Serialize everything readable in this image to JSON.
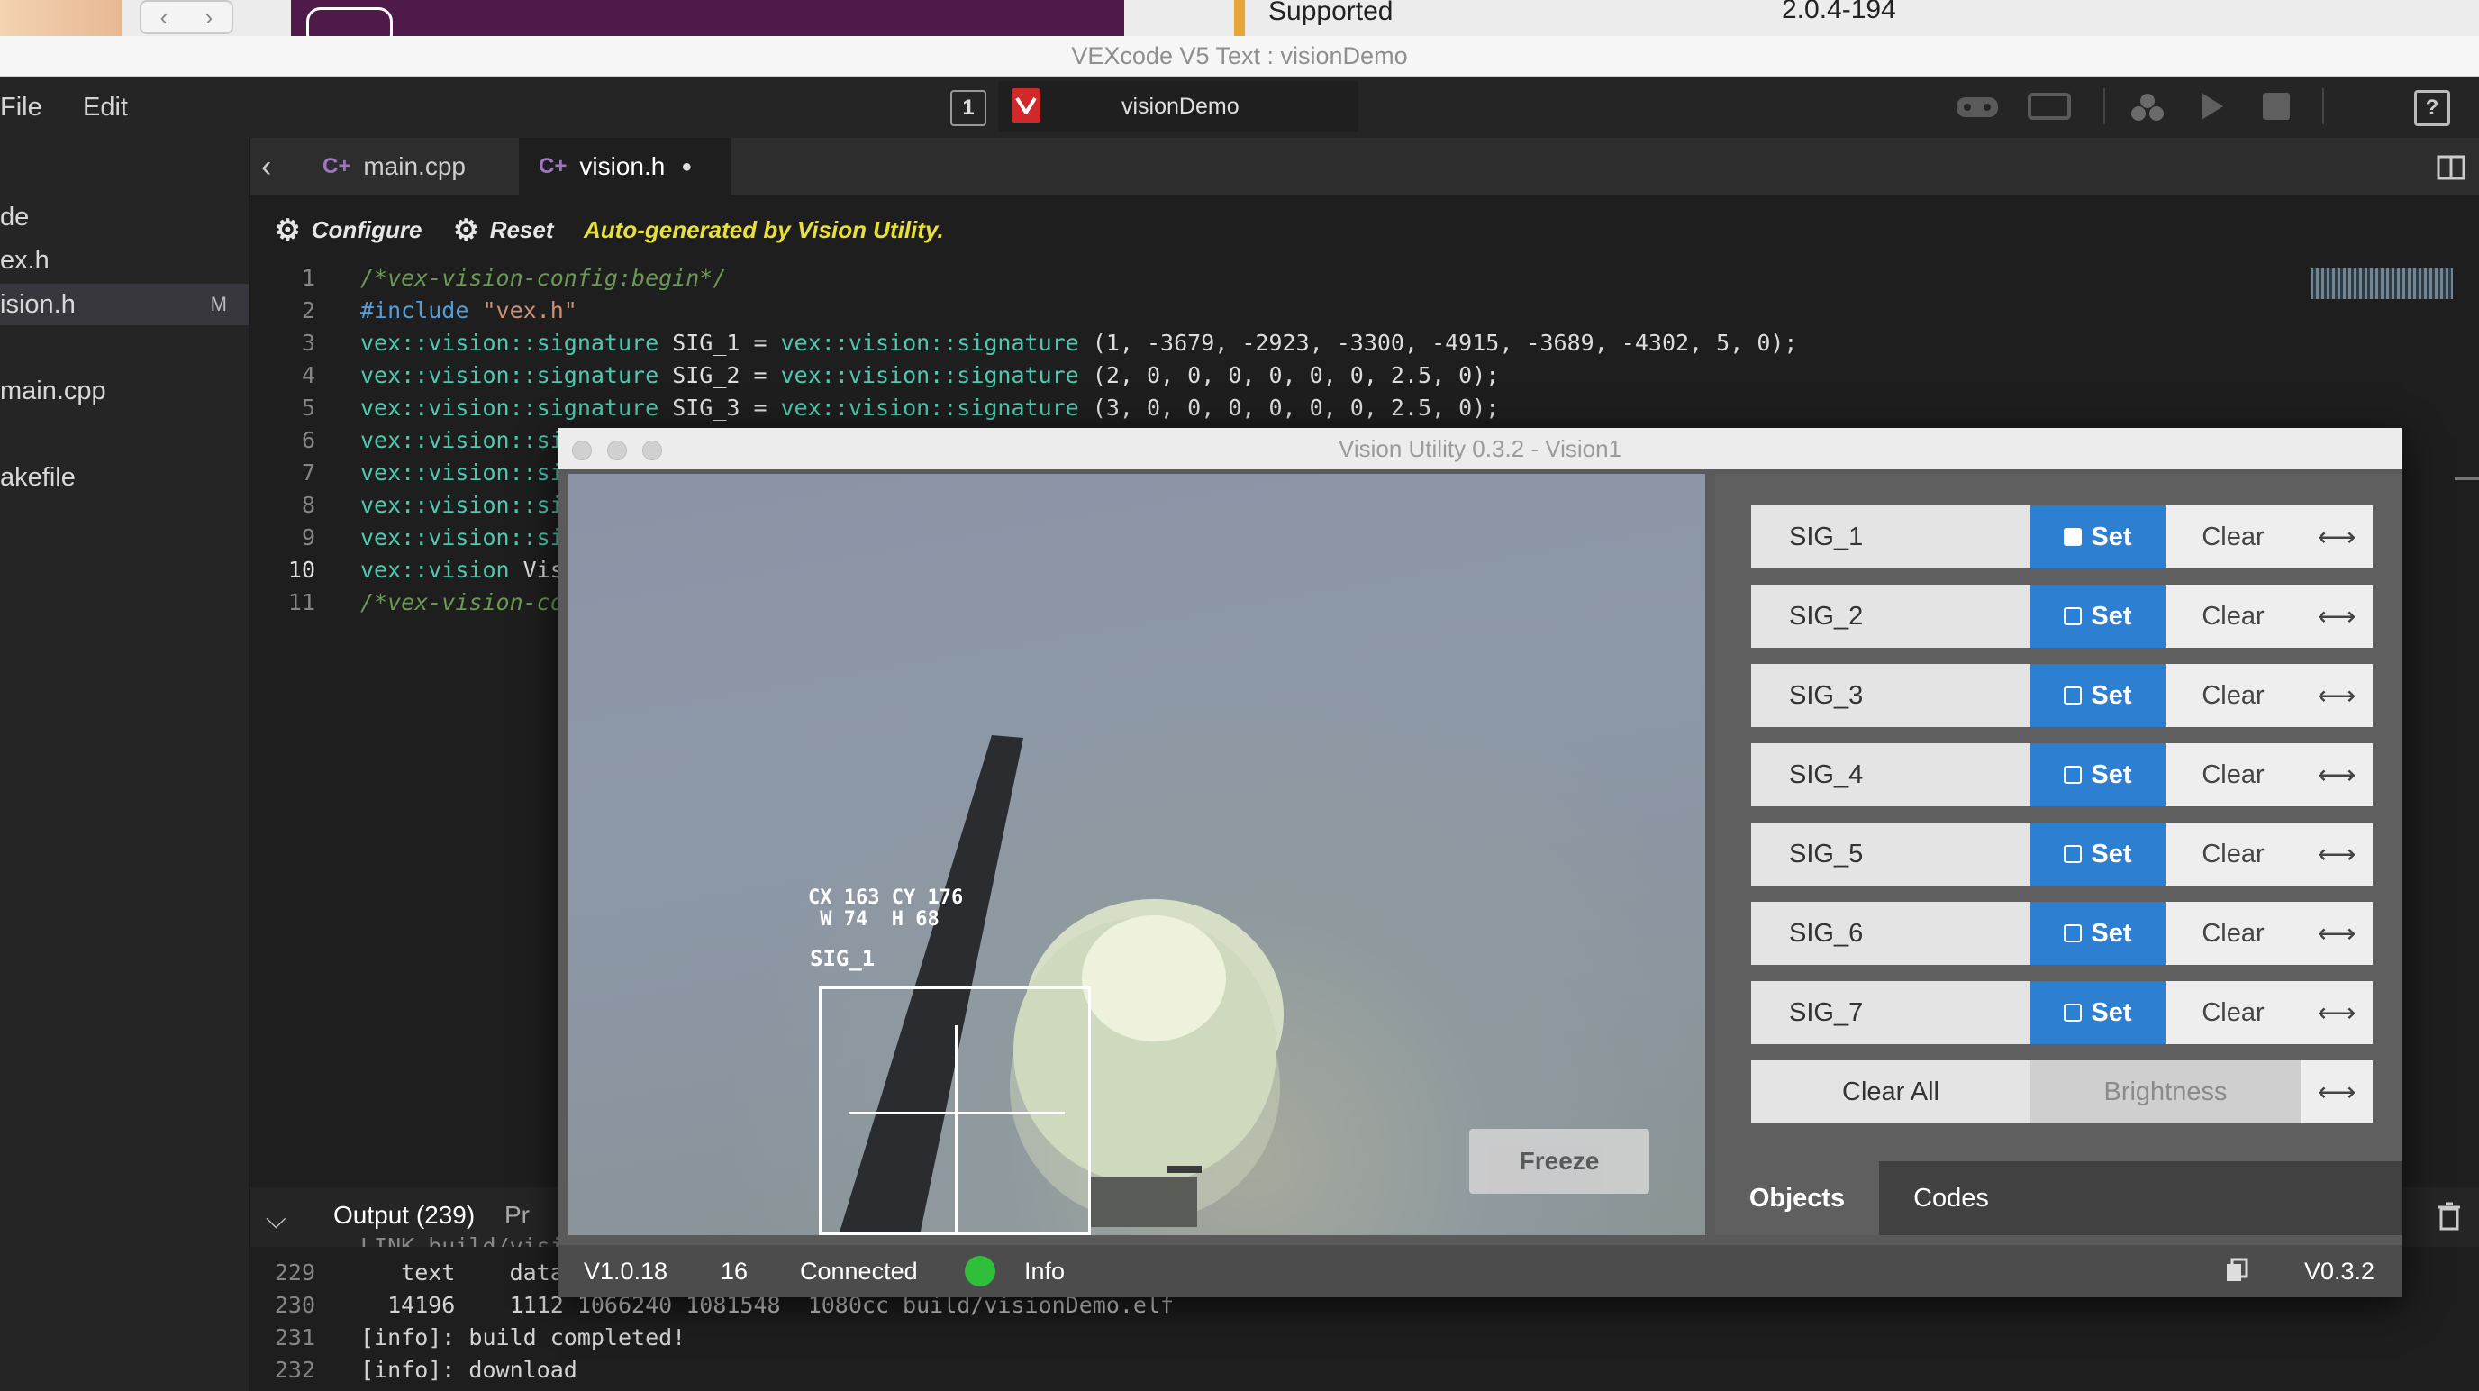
{
  "background": {
    "bg_supported": "Supported",
    "bg_version": "2.0.4-194"
  },
  "window_title": "VEXcode V5 Text : visionDemo",
  "menu": {
    "file": "File",
    "edit": "Edit"
  },
  "project": {
    "slot": "1",
    "name": "visionDemo"
  },
  "sidebar": {
    "items": [
      {
        "label": "de"
      },
      {
        "label": "ex.h"
      },
      {
        "label": "ision.h",
        "badge": "M"
      },
      {
        "label": "main.cpp"
      },
      {
        "label": "akefile"
      }
    ]
  },
  "tabs": [
    {
      "label": "main.cpp"
    },
    {
      "label": "vision.h",
      "modified_dot": "●"
    }
  ],
  "toolbar": {
    "configure": "Configure",
    "reset": "Reset",
    "autogen": "Auto-generated by Vision Utility."
  },
  "code": {
    "ln": [
      "1",
      "2",
      "3",
      "4",
      "5",
      "6",
      "7",
      "8",
      "9",
      "10",
      "11"
    ],
    "l1": "/*vex-vision-config:begin*/",
    "l2_pp": "#include ",
    "l2_str": "\"vex.h\"",
    "l3_t1": "vex::vision::signature",
    "l3_mid": " SIG_1 = ",
    "l3_t2": "vex::vision::signature",
    "l3_args": " (1, -3679, -2923, -3300, -4915, -3689, -4302, 5, 0);",
    "l4_t1": "vex::vision::signature",
    "l4_mid": " SIG_2 = ",
    "l4_t2": "vex::vision::signature",
    "l4_args": " (2, 0, 0, 0, 0, 0, 0, 2.5, 0);",
    "l5_t1": "vex::vision::signature",
    "l5_mid": " SIG_3 = ",
    "l5_t2": "vex::vision::signature",
    "l5_args": " (3, 0, 0, 0, 0, 0, 0, 2.5, 0);",
    "l6": "vex::vision::si",
    "l7": "vex::vision::si",
    "l8": "vex::vision::si",
    "l9": "vex::vision::si",
    "l10_t": "vex::vision",
    "l10_rest": " Vis",
    "l11": "/*vex-vision-co"
  },
  "output": {
    "tab": "Output (239)",
    "tab2": "Pr",
    "partial_line": "LINK build/visi",
    "lines": [
      {
        "n": "229",
        "text": "   text    data"
      },
      {
        "n": "230",
        "text": "  14196    1112 1066240 1081548  1080cc build/visionDemo.elf"
      },
      {
        "n": "231",
        "text": "[info]: build completed!"
      },
      {
        "n": "232",
        "text": "[info]: download"
      }
    ]
  },
  "vision_utility": {
    "title": "Vision Utility 0.3.2 - Vision1",
    "overlay": {
      "coords": "CX 163 CY 176",
      "size": " W 74  H 68",
      "label": "SIG_1"
    },
    "freeze": "Freeze",
    "signatures": [
      {
        "name": "SIG_1",
        "set": "Set",
        "clear": "Clear",
        "arrow": "⟷",
        "set_filled": true
      },
      {
        "name": "SIG_2",
        "set": "Set",
        "clear": "Clear",
        "arrow": "⟷",
        "set_filled": false
      },
      {
        "name": "SIG_3",
        "set": "Set",
        "clear": "Clear",
        "arrow": "⟷",
        "set_filled": false
      },
      {
        "name": "SIG_4",
        "set": "Set",
        "clear": "Clear",
        "arrow": "⟷",
        "set_filled": false
      },
      {
        "name": "SIG_5",
        "set": "Set",
        "clear": "Clear",
        "arrow": "⟷",
        "set_filled": false
      },
      {
        "name": "SIG_6",
        "set": "Set",
        "clear": "Clear",
        "arrow": "⟷",
        "set_filled": false
      },
      {
        "name": "SIG_7",
        "set": "Set",
        "clear": "Clear",
        "arrow": "⟷",
        "set_filled": false
      }
    ],
    "clear_all": "Clear All",
    "brightness": "Brightness",
    "brightness_arrow": "⟷",
    "tabs": {
      "objects": "Objects",
      "codes": "Codes"
    },
    "status": {
      "firmware": "V1.0.18",
      "port": "16",
      "connection": "Connected",
      "info": "Info",
      "version": "V0.3.2"
    }
  },
  "colors": {
    "accent_blue": "#2d7fd1",
    "connected_green": "#2fbf3a",
    "autogen_yellow": "#e8e03a",
    "vex_red": "#d0282b"
  }
}
